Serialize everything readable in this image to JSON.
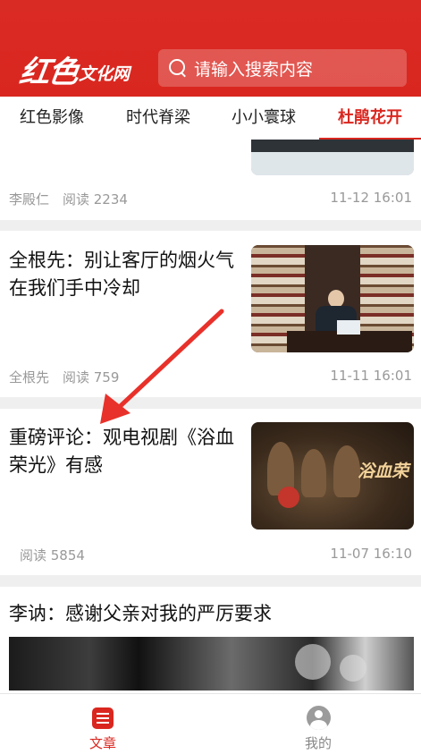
{
  "header": {
    "logo_main": "红色",
    "logo_sub": "文化网",
    "search_placeholder": "请输入搜索内容"
  },
  "tabs": [
    {
      "label": "红色影像"
    },
    {
      "label": "时代脊梁"
    },
    {
      "label": "小小寰球"
    },
    {
      "label": "杜鹃花开",
      "active": true
    }
  ],
  "feed": [
    {
      "author": "李殿仁",
      "reads": "阅读 2234",
      "time": "11-12 16:01"
    },
    {
      "title": "全根先：别让客厅的烟火气在我们手中冷却",
      "author": "全根先",
      "reads": "阅读 759",
      "time": "11-11 16:01"
    },
    {
      "title": "重磅评论：观电视剧《浴血荣光》有感",
      "thumb_caption": "浴血荣",
      "reads": "阅读 5854",
      "time": "11-07 16:10"
    },
    {
      "title": "李讷：感谢父亲对我的严厉要求"
    }
  ],
  "bottom_nav": [
    {
      "label": "文章",
      "icon": "article-icon",
      "active": true
    },
    {
      "label": "我的",
      "icon": "profile-icon"
    }
  ],
  "colors": {
    "brand_red": "#d9271f",
    "meta_gray": "#999999",
    "annotation_red": "#e8312a"
  }
}
